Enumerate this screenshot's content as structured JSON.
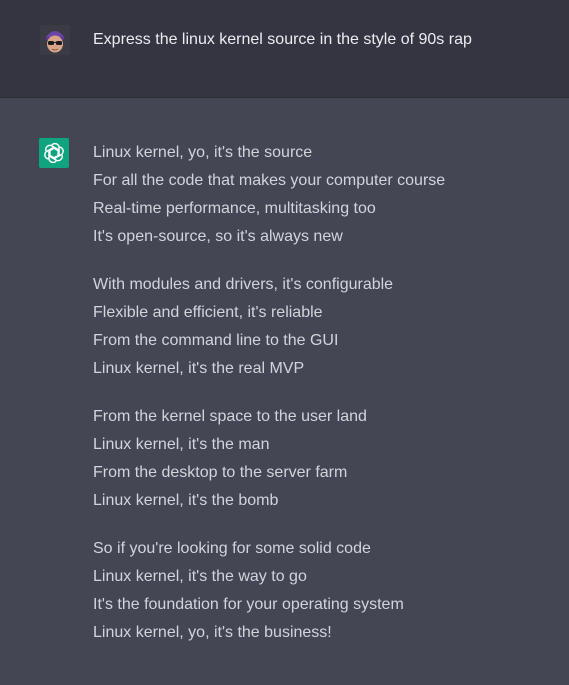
{
  "user_message": {
    "avatar_icon": "user-avatar",
    "text": "Express the linux kernel source in the style of 90s rap"
  },
  "assistant_message": {
    "logo_icon": "openai-logo-icon",
    "logo_color": "#10a37f",
    "stanzas": [
      {
        "lines": [
          "Linux kernel, yo, it's the source",
          "For all the code that makes your computer course",
          "Real-time performance, multitasking too",
          "It's open-source, so it's always new"
        ]
      },
      {
        "lines": [
          "With modules and drivers, it's configurable",
          "Flexible and efficient, it's reliable",
          "From the command line to the GUI",
          "Linux kernel, it's the real MVP"
        ]
      },
      {
        "lines": [
          "From the kernel space to the user land",
          "Linux kernel, it's the man",
          "From the desktop to the server farm",
          "Linux kernel, it's the bomb"
        ]
      },
      {
        "lines": [
          "So if you're looking for some solid code",
          "Linux kernel, it's the way to go",
          "It's the foundation for your operating system",
          "Linux kernel, yo, it's the business!"
        ]
      }
    ]
  }
}
